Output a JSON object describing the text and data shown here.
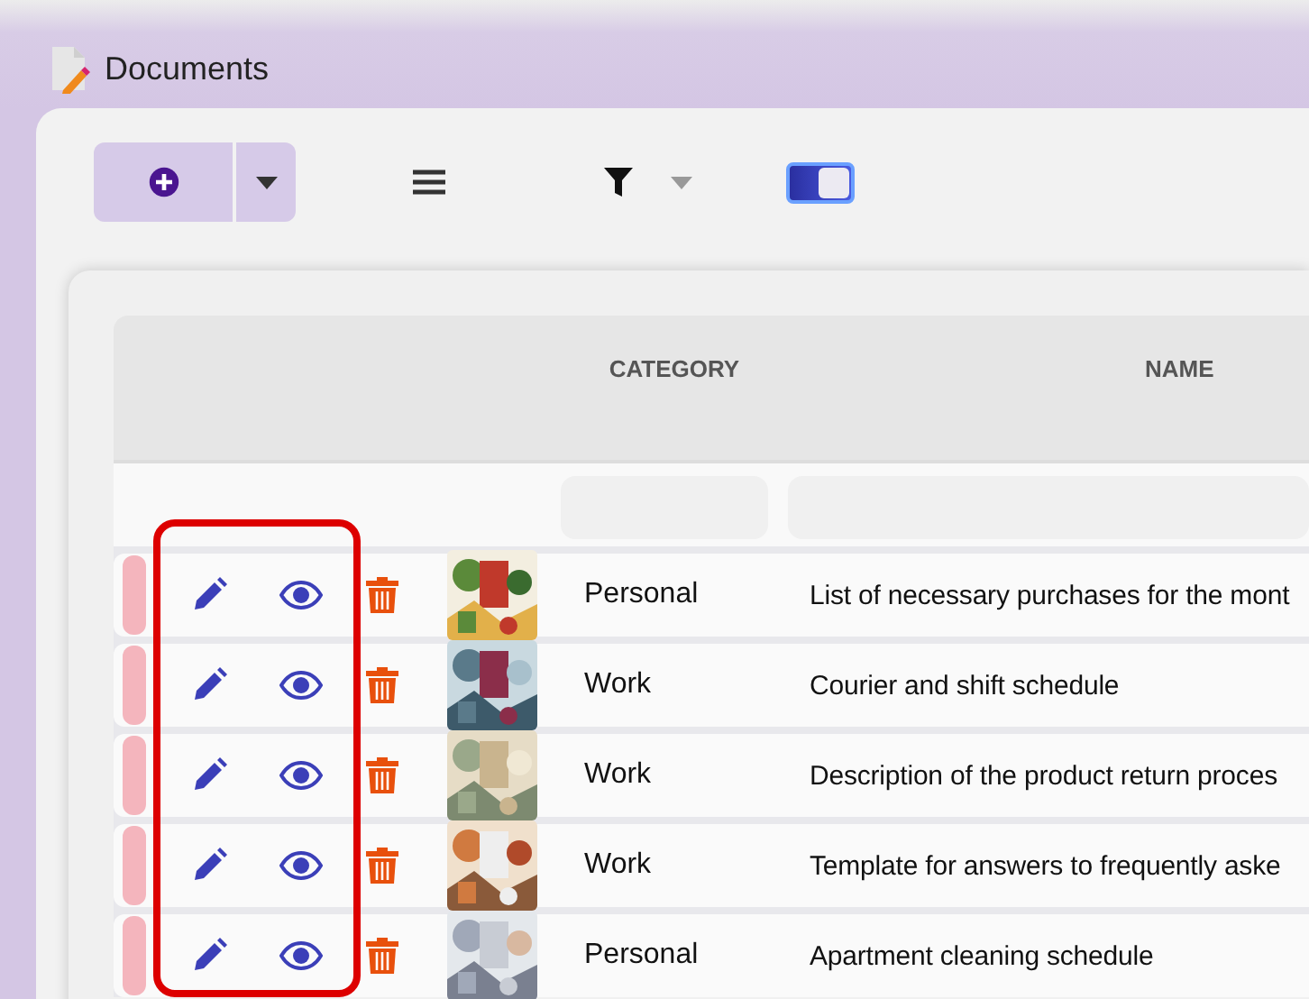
{
  "window": {
    "title": "Documents"
  },
  "toolbar": {
    "toggle": {
      "on": true
    }
  },
  "table": {
    "columns": [
      "CATEGORY",
      "NAME"
    ],
    "rows": [
      {
        "category": "Personal",
        "name": "List of necessary purchases for the mont"
      },
      {
        "category": "Work",
        "name": "Courier and shift schedule"
      },
      {
        "category": "Work",
        "name": "Description of the product return proces"
      },
      {
        "category": "Work",
        "name": "Template for answers to frequently aske"
      },
      {
        "category": "Personal",
        "name": "Apartment cleaning schedule"
      }
    ]
  }
}
